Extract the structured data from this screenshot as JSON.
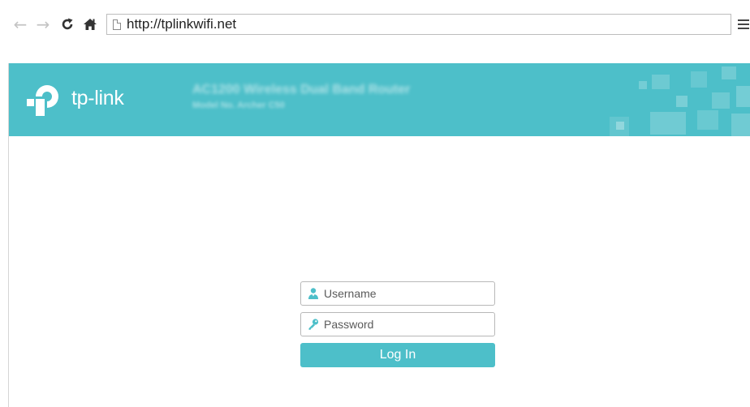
{
  "browser": {
    "url": "http://tplinkwifi.net",
    "nav_icons": [
      "back-arrow-icon",
      "forward-arrow-icon",
      "reload-icon",
      "home-icon"
    ],
    "menu_icon": "hamburger-menu-icon"
  },
  "header": {
    "brand": "tp-link",
    "model_title": "AC1200 Wireless Dual Band Router",
    "model_subtitle": "Model No. Archer C50",
    "color": "#4dbfc9"
  },
  "login": {
    "username_placeholder": "Username",
    "password_placeholder": "Password",
    "username_icon": "user-icon",
    "password_icon": "key-icon",
    "button_label": "Log In",
    "button_color": "#4dbfc9"
  }
}
